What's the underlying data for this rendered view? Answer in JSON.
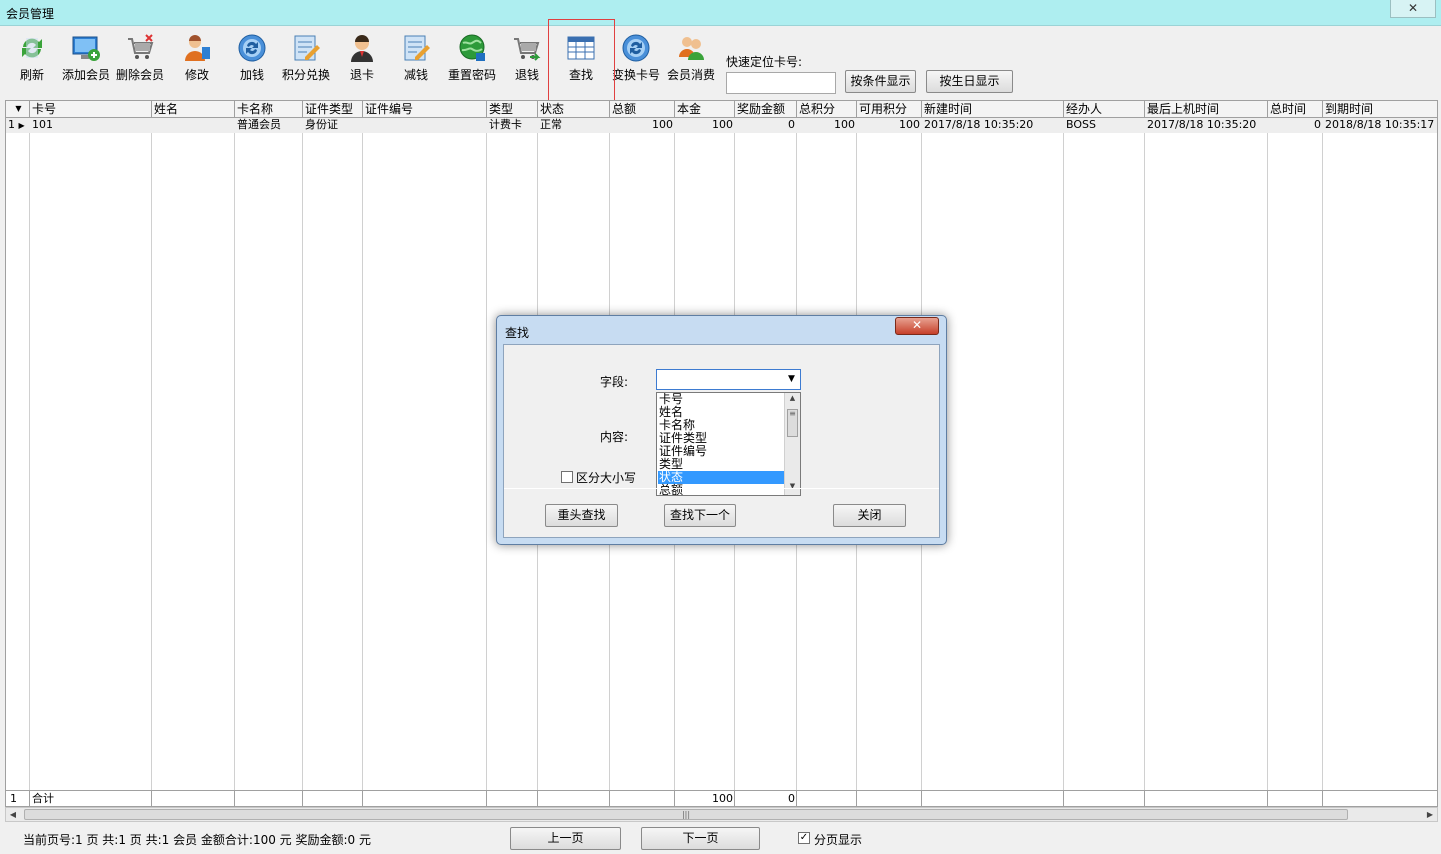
{
  "window": {
    "title": "会员管理",
    "close": "✕"
  },
  "toolbar": {
    "buttons": [
      {
        "label": "刷新",
        "icon": "refresh-icon"
      },
      {
        "label": "添加会员",
        "icon": "add-member-icon"
      },
      {
        "label": "删除会员",
        "icon": "delete-member-icon"
      },
      {
        "label": "修改",
        "icon": "edit-user-icon"
      },
      {
        "label": "加钱",
        "icon": "add-money-icon"
      },
      {
        "label": "积分兑换",
        "icon": "points-exchange-icon"
      },
      {
        "label": "退卡",
        "icon": "return-card-icon"
      },
      {
        "label": "减钱",
        "icon": "subtract-money-icon"
      },
      {
        "label": "重置密码",
        "icon": "reset-password-icon"
      },
      {
        "label": "退钱",
        "icon": "refund-icon"
      },
      {
        "label": "查找",
        "icon": "find-icon"
      },
      {
        "label": "变换卡号",
        "icon": "change-card-icon"
      },
      {
        "label": "会员消费",
        "icon": "member-consume-icon"
      }
    ],
    "quick_locate_label": "快速定位卡号:",
    "quick_locate_value": "",
    "by_condition_label": "按条件显示",
    "by_birthday_label": "按生日显示"
  },
  "grid": {
    "columns": [
      "卡号",
      "姓名",
      "卡名称",
      "证件类型",
      "证件编号",
      "类型",
      "状态",
      "总额",
      "本金",
      "奖励金额",
      "总积分",
      "可用积分",
      "新建时间",
      "经办人",
      "最后上机时间",
      "总时间",
      "到期时间"
    ],
    "rows": [
      {
        "index": "1",
        "cells": [
          "101",
          "",
          "普通会员",
          "身份证",
          "",
          "计费卡",
          "正常",
          "100",
          "100",
          "0",
          "100",
          "100",
          "2017/8/18 10:35:20",
          "BOSS",
          "2017/8/18 10:35:20",
          "0",
          "2018/8/18 10:35:17"
        ]
      }
    ],
    "footer": {
      "index": "1",
      "label": "合计",
      "total": "100",
      "bonus": "0"
    }
  },
  "status": {
    "text": "当前页号:1 页 共:1 页 共:1 会员 金额合计:100 元 奖励金额:0 元",
    "prev_label": "上一页",
    "next_label": "下一页",
    "paging_label": "分页显示",
    "paging_checked": true
  },
  "find_dialog": {
    "title": "查找",
    "close": "✕",
    "field_label": "字段:",
    "field_value": "",
    "content_label": "内容:",
    "case_label": "区分大小写",
    "case_checked": false,
    "options": [
      "卡号",
      "姓名",
      "卡名称",
      "证件类型",
      "证件编号",
      "类型",
      "状态",
      "总额"
    ],
    "selected_option": "状态",
    "restart_label": "重头查找",
    "find_next_label": "查找下一个",
    "close_label": "关闭"
  }
}
